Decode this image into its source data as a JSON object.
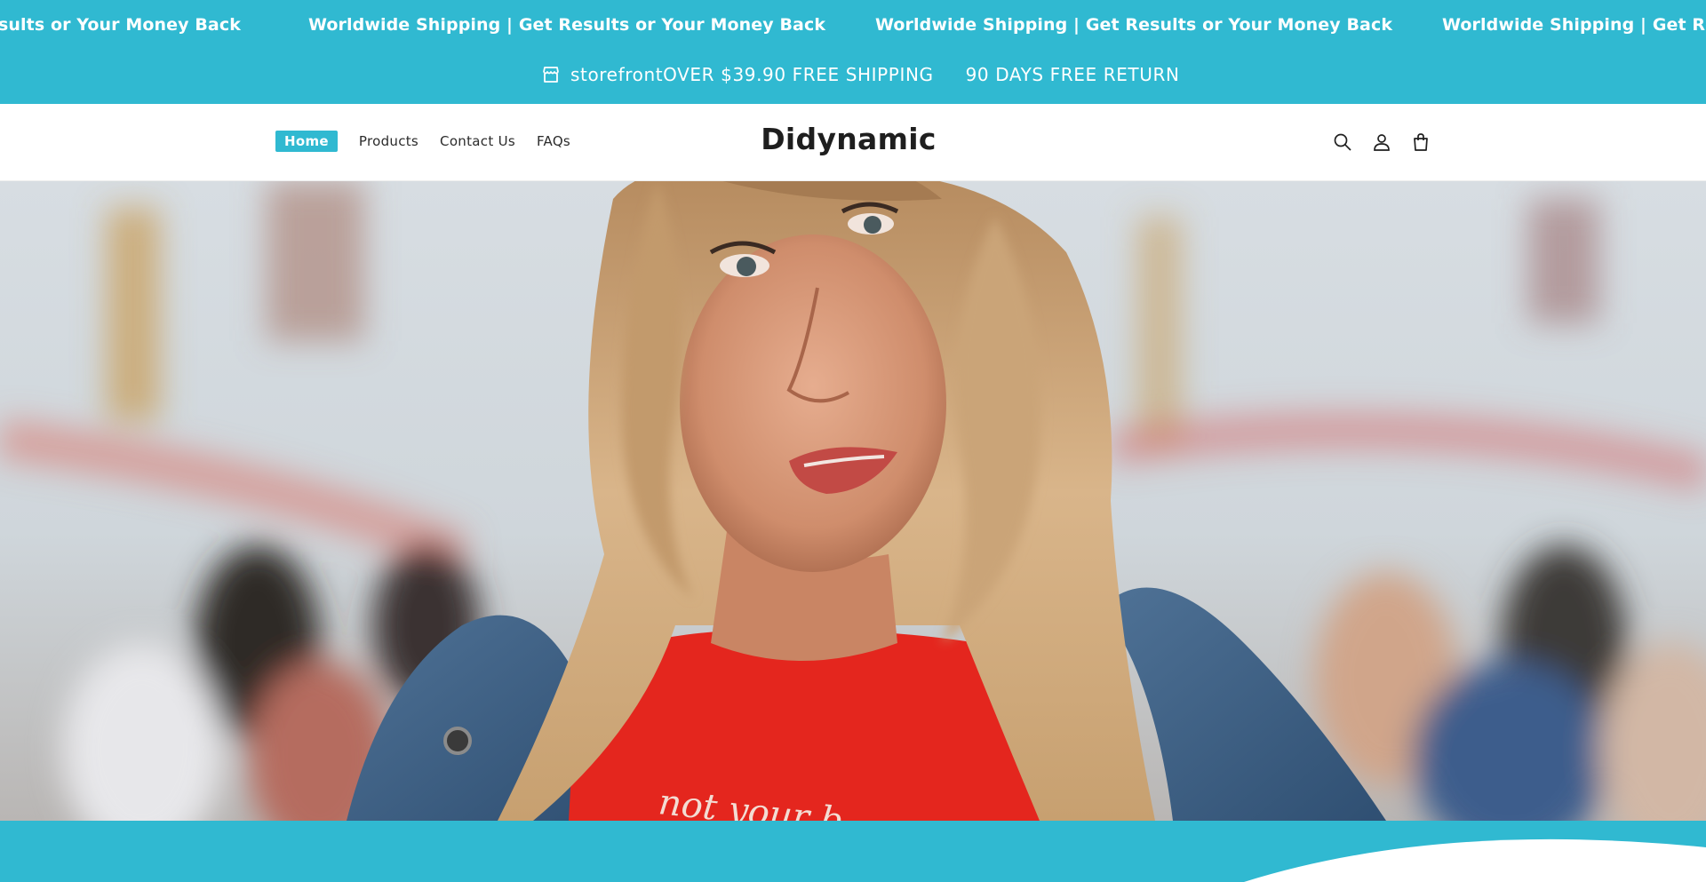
{
  "marquee": {
    "items": [
      "sults or Your Money Back",
      "Worldwide Shipping | Get Results or Your Money Back",
      "Worldwide Shipping | Get Results or Your Money Back",
      "Worldwide Shipping | Get Res"
    ]
  },
  "announcement": {
    "icon": "storefront-icon",
    "text_1": "storefrontOVER $39.90 FREE SHIPPING",
    "text_2": "90 DAYS FREE RETURN"
  },
  "header": {
    "logo": "Didynamic",
    "nav": [
      {
        "label": "Home",
        "active": true
      },
      {
        "label": "Products",
        "active": false
      },
      {
        "label": "Contact Us",
        "active": false
      },
      {
        "label": "FAQs",
        "active": false
      }
    ],
    "icons": [
      "search-icon",
      "account-icon",
      "cart-icon"
    ]
  },
  "hero": {
    "shirt_text": "not your b"
  },
  "colors": {
    "accent": "#30b9d1",
    "text": "#1f1f1f",
    "white": "#ffffff"
  }
}
